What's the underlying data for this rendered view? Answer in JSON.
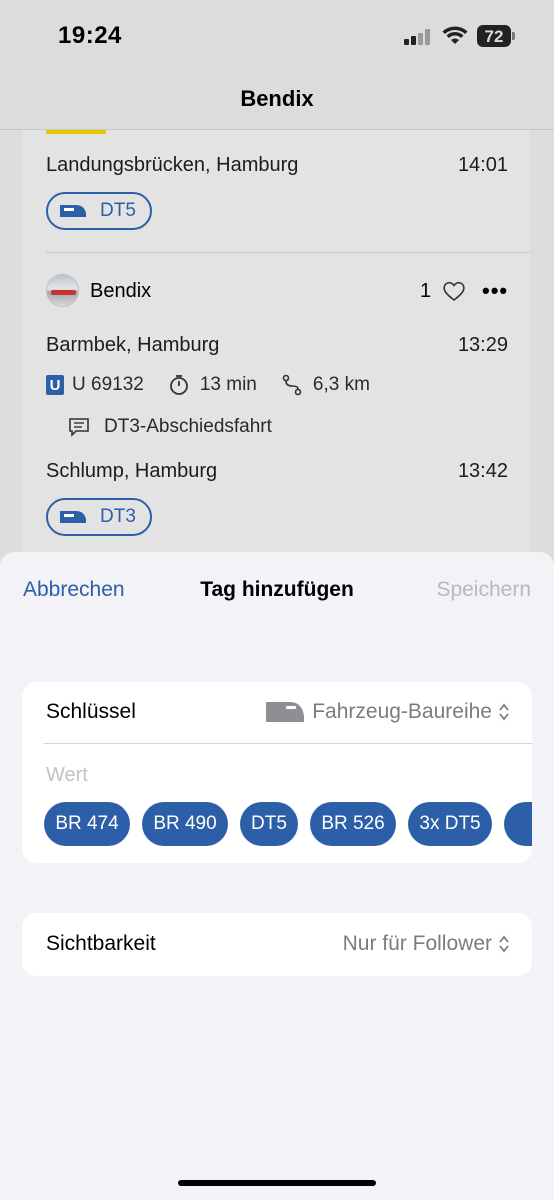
{
  "status_bar": {
    "time": "19:24",
    "battery": "72"
  },
  "nav": {
    "title": "Bendix"
  },
  "feed": {
    "first_entry": {
      "station": "Landungsbrücken, Hamburg",
      "time": "14:01",
      "tag": "DT5"
    },
    "post": {
      "user": "Bendix",
      "likes": "1",
      "departure_station": "Barmbek, Hamburg",
      "departure_time": "13:29",
      "line": "U 69132",
      "line_badge": "U",
      "duration": "13 min",
      "distance": "6,3 km",
      "comment": "DT3-Abschiedsfahrt",
      "arrival_station": "Schlump, Hamburg",
      "arrival_time": "13:42",
      "tag": "DT3"
    }
  },
  "sheet": {
    "cancel_label": "Abbrechen",
    "title": "Tag hinzufügen",
    "save_label": "Speichern",
    "key_label": "Schlüssel",
    "key_value": "Fahrzeug-Baureihe",
    "value_placeholder": "Wert",
    "suggestions": [
      "BR 474",
      "BR 490",
      "DT5",
      "BR 526",
      "3x DT5"
    ],
    "visibility_label": "Sichtbarkeit",
    "visibility_value": "Nur für Follower"
  },
  "colors": {
    "accent": "#2c5fa8",
    "disabled": "#b8b8bd",
    "sheet_bg": "#f2f2f7",
    "yellow": "#e7c600"
  }
}
